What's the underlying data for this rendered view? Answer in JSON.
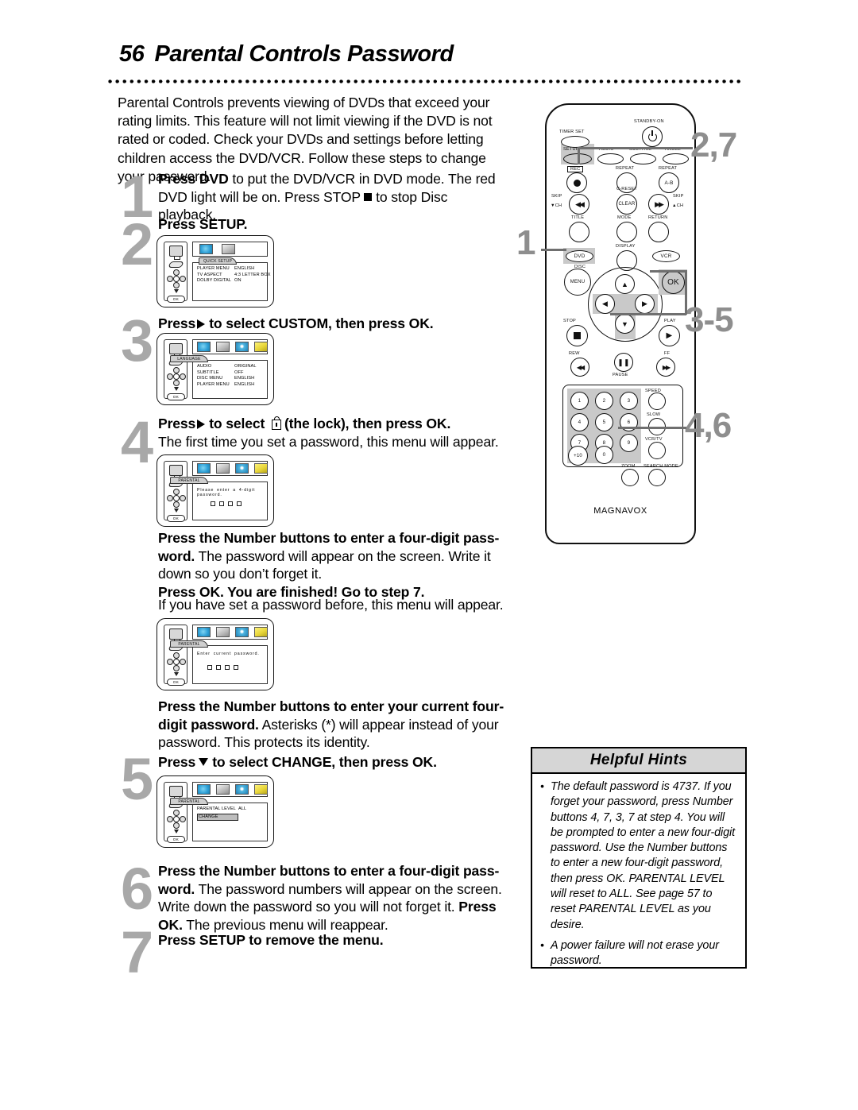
{
  "header": {
    "page_number": "56",
    "title": "Parental Controls Password"
  },
  "intro": "Parental Controls prevents viewing of DVDs that exceed your rating limits. This feature will not limit viewing if the DVD is not rated or coded. Check your DVDs and settings before letting children access the DVD/VCR. Follow these steps to change your password.",
  "steps": {
    "one": {
      "num": "1",
      "text_a": "Press DVD",
      "text_b": " to put the DVD/VCR in DVD mode. The red DVD light will be on. Press STOP ",
      "text_c": " to stop Disc playback."
    },
    "two": {
      "num": "2",
      "text": "Press SETUP."
    },
    "three": {
      "num": "3",
      "text_a": "Press",
      "text_b": "to select CUSTOM, then press OK."
    },
    "four": {
      "num": "4",
      "text_a": "Press",
      "text_b": "to select",
      "text_c": "(the lock), then press OK.",
      "sub": "The first time you set a password, this menu will appear."
    },
    "five": {
      "num": "5",
      "text_a": "Press",
      "text_b": "to select CHANGE, then press OK."
    },
    "six": {
      "num": "6",
      "bold_a": "Press the Number buttons to enter a four-digit pass-word.",
      "rest_a": " The password numbers will appear on the screen. Write down the password so you will not forget it. ",
      "bold_b": "Press OK.",
      "rest_b": " The previous menu will reappear."
    },
    "seven": {
      "num": "7",
      "text": "Press SETUP to remove the menu."
    }
  },
  "blocks": {
    "after_four": {
      "bold": "Press the Number buttons to enter a four-digit pass-word.",
      "rest": " The password will appear on the screen. Write it down so you don’t forget it.",
      "bold2": "Press OK. You are finished! Go to step 7.",
      "note": "If you have set a password before, this menu will appear."
    },
    "after_five_menu": {
      "bold": "Press the Number buttons to enter your current four-digit password.",
      "rest": " Asterisks (*) will appear instead of your password. This protects its identity."
    }
  },
  "osd": {
    "quick_setup": {
      "tab": "QUICK SETUP",
      "ok": "OK",
      "rows": [
        {
          "key": "PLAYER MENU",
          "value": "ENGLISH"
        },
        {
          "key": "TV ASPECT",
          "value": "4:3 LETTER BOX"
        },
        {
          "key": "DOLBY DIGITAL",
          "value": "ON"
        }
      ]
    },
    "language": {
      "tab": "LANGUAGE",
      "ok": "OK",
      "rows": [
        {
          "key": "AUDIO",
          "value": "ORIGINAL"
        },
        {
          "key": "SUBTITLE",
          "value": "OFF"
        },
        {
          "key": "DISC MENU",
          "value": "ENGLISH"
        },
        {
          "key": "PLAYER MENU",
          "value": "ENGLISH"
        }
      ]
    },
    "parental_new": {
      "tab": "PARENTAL",
      "ok": "OK",
      "message": "Please enter a 4-digit password."
    },
    "parental_current": {
      "tab": "PARENTAL",
      "ok": "OK",
      "message": "Enter current password."
    },
    "parental_level": {
      "tab": "PARENTAL",
      "ok": "OK",
      "row_key": "PARENTAL LEVEL",
      "row_value": "ALL",
      "highlight": "CHANGE"
    }
  },
  "remote": {
    "brand": "MAGNAVOX",
    "buttons": {
      "timer_set": "TIMER SET",
      "standby_on": "STANDBY-ON",
      "setup": "SETUP",
      "audio": "AUDIO",
      "subtitle": "SUBTITLE",
      "angle": "ANGLE",
      "rec": "REC",
      "repeat": "REPEAT",
      "repeat_ab_label": "REPEAT",
      "repeat_ab": "A-B",
      "skip_down": "SKIP",
      "skip_down2": "▼CH",
      "c_reset": "C-RESET",
      "clear": "CLEAR",
      "skip_up": "SKIP",
      "skip_up2": "▲CH",
      "title": "TITLE",
      "mode": "MODE",
      "return": "RETURN",
      "display": "DISPLAY",
      "dvd": "DVD",
      "vcr": "VCR",
      "disc": "DISC",
      "menu": "MENU",
      "ok": "OK",
      "stop": "STOP",
      "play": "PLAY",
      "rew": "REW",
      "pause": "PAUSE",
      "ff": "FF",
      "speed": "SPEED",
      "slow": "SLOW",
      "vcr_tv": "VCR/TV",
      "zoom": "ZOOM",
      "search_mode": "SEARCH MODE",
      "plus_ten": "+10"
    },
    "numbers": [
      "1",
      "2",
      "3",
      "4",
      "5",
      "6",
      "7",
      "8",
      "9",
      "0"
    ]
  },
  "callouts": {
    "left_one": "1",
    "top": "2,7",
    "middle": "3-5",
    "bottom": "4,6"
  },
  "hints": {
    "title": "Helpful Hints",
    "items": [
      "The default password is 4737. If you forget your password, press Number buttons 4, 7, 3, 7 at step 4. You will be prompted to enter a new four-digit password. Use the Number buttons to enter a new four-digit password, then press OK. PARENTAL LEVEL will reset to ALL. See page 57 to reset PARENTAL LEVEL as you desire.",
      "A power failure will not erase your password."
    ]
  },
  "colors": {
    "step_number": "#a8a8a8",
    "callout": "#8e8e8e",
    "highlight": "#c9c9c9",
    "hints_header": "#d6d6d6"
  }
}
